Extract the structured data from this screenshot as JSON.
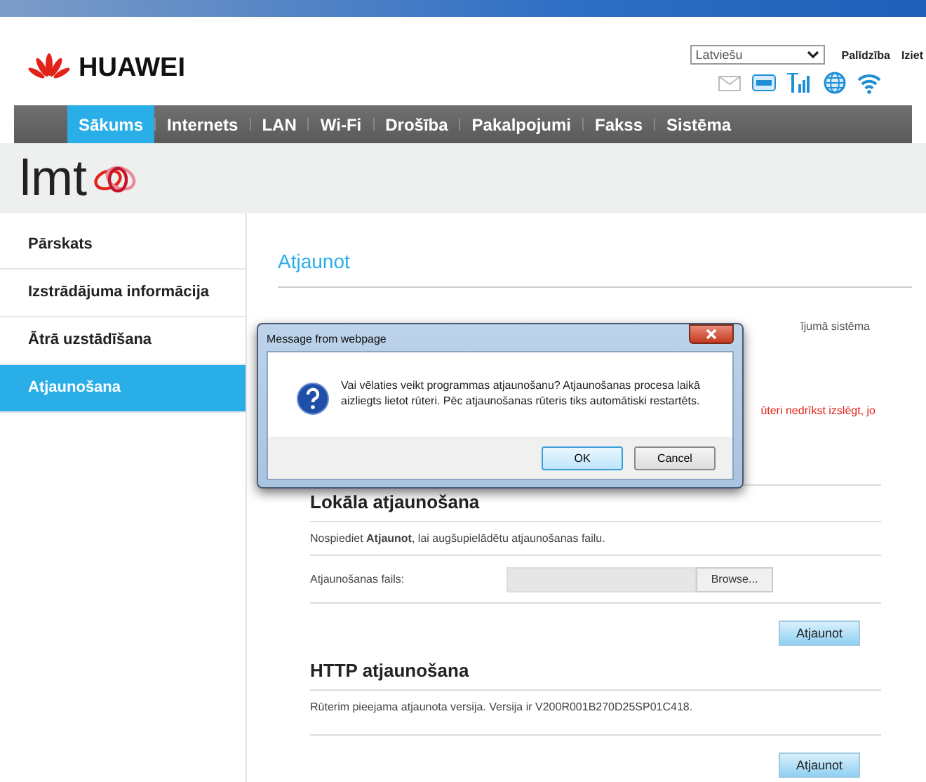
{
  "header": {
    "logo_text": "HUAWEI",
    "language_select": {
      "value": "Latviešu"
    },
    "links": [
      "Palīdzība",
      "Iziet"
    ]
  },
  "nav": [
    {
      "label": "Sākums",
      "selected": true
    },
    {
      "label": "Internets",
      "selected": false
    },
    {
      "label": "LAN",
      "selected": false
    },
    {
      "label": "Wi-Fi",
      "selected": false
    },
    {
      "label": "Drošība",
      "selected": false
    },
    {
      "label": "Pakalpojumi",
      "selected": false
    },
    {
      "label": "Fakss",
      "selected": false
    },
    {
      "label": "Sistēma",
      "selected": false
    }
  ],
  "brand": "lmt",
  "sidebar": [
    {
      "label": "Pārskats",
      "selected": false
    },
    {
      "label": "Izstrādājuma informācija",
      "selected": false
    },
    {
      "label": "Ātrā uzstādīšana",
      "selected": false
    },
    {
      "label": "Atjaunošana",
      "selected": true
    }
  ],
  "page_title": "Atjaunot",
  "obscured_texts": [
    {
      "text": "ījumā sistēma",
      "kind": "normal"
    },
    {
      "text": "ūteri nedrīkst izslēgt, jo",
      "kind": "warning"
    }
  ],
  "local_update": {
    "heading": "Lokāla atjaunošana",
    "description": "Nospiediet **Atjaunot**, lai augšupielādētu atjaunošanas failu.",
    "file_label": "Atjaunošanas fails:",
    "browse_button": "Browse...",
    "submit_button": "Atjaunot"
  },
  "http_update": {
    "heading": "HTTP atjaunošana",
    "description": "Rūterim pieejama atjaunota versija. Versija ir V200R001B270D25SP01C418.",
    "submit_button": "Atjaunot"
  },
  "dialog": {
    "title": "Message from webpage",
    "message": "Vai vēlaties veikt programmas atjaunošanu? Atjaunošanas procesa laikā aizliegts lietot rūteri. Pēc atjaunošanas rūteris tiks automātiski restartēts.",
    "buttons": [
      {
        "label": "OK",
        "selected": true
      },
      {
        "label": "Cancel",
        "selected": false
      }
    ]
  }
}
